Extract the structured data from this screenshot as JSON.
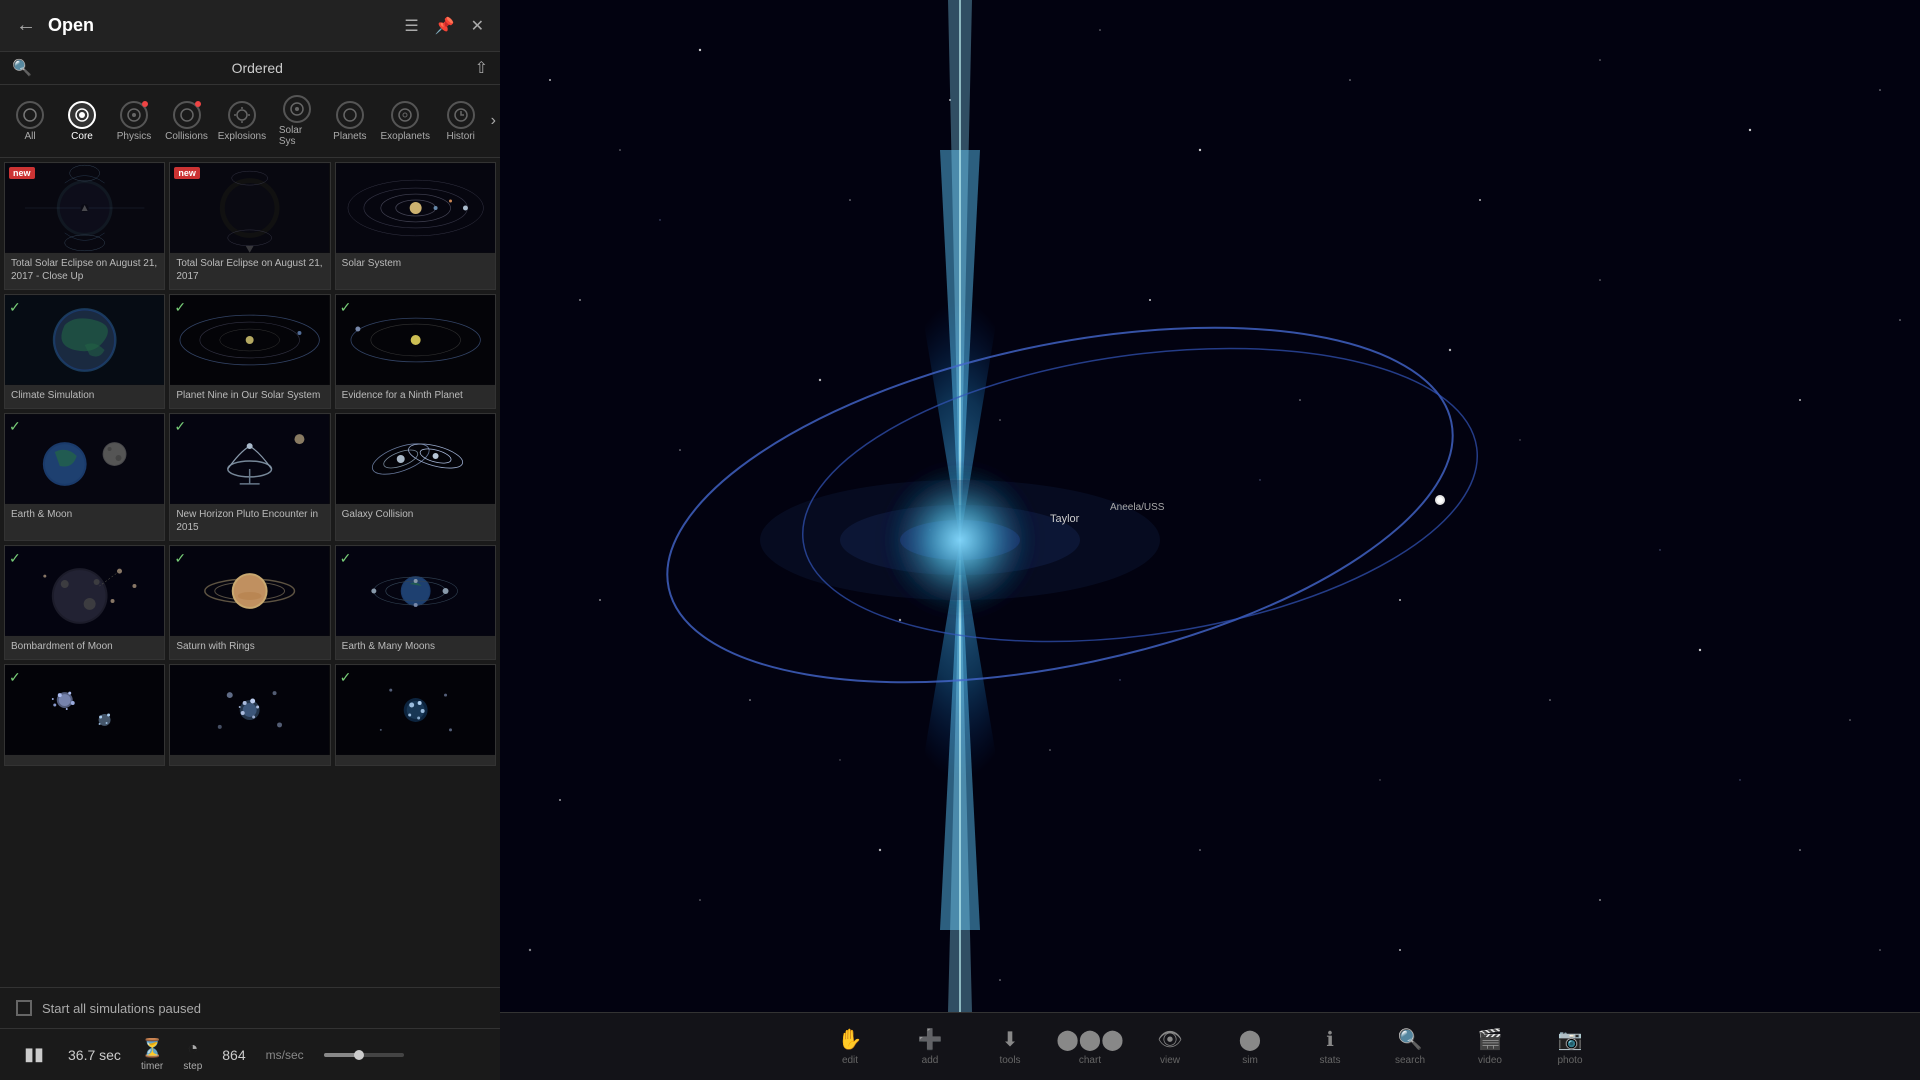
{
  "panel": {
    "title": "Open",
    "ordered_label": "Ordered",
    "categories": [
      {
        "id": "all",
        "label": "All",
        "active": false,
        "dot": false
      },
      {
        "id": "core",
        "label": "Core",
        "active": true,
        "dot": false
      },
      {
        "id": "physics",
        "label": "Physics",
        "active": false,
        "dot": true
      },
      {
        "id": "collisions",
        "label": "Collisions",
        "active": false,
        "dot": true
      },
      {
        "id": "explosions",
        "label": "Explosions",
        "active": false,
        "dot": false
      },
      {
        "id": "solarsys",
        "label": "Solar Sys",
        "active": false,
        "dot": false
      },
      {
        "id": "planets",
        "label": "Planets",
        "active": false,
        "dot": false
      },
      {
        "id": "exoplanets",
        "label": "Exoplanets",
        "active": false,
        "dot": false
      },
      {
        "id": "histori",
        "label": "Histori",
        "active": false,
        "dot": false
      }
    ],
    "simulations": [
      {
        "row": 0,
        "items": [
          {
            "id": "eclipse-closeup",
            "title": "Total Solar Eclipse on August 21, 2017 - Close Up",
            "new": true,
            "checked": false,
            "thumb": "eclipse"
          },
          {
            "id": "eclipse-2017",
            "title": "Total Solar Eclipse on August 21, 2017",
            "new": true,
            "checked": false,
            "thumb": "eclipse2"
          },
          {
            "id": "solar-system",
            "title": "Solar System",
            "new": false,
            "checked": true,
            "thumb": "solar"
          }
        ]
      },
      {
        "row": 1,
        "items": [
          {
            "id": "climate",
            "title": "Climate Simulation",
            "new": false,
            "checked": true,
            "thumb": "climate"
          },
          {
            "id": "planet9",
            "title": "Planet Nine in Our Solar System",
            "new": false,
            "checked": true,
            "thumb": "planet9"
          },
          {
            "id": "ninth-planet",
            "title": "Evidence for a Ninth Planet",
            "new": false,
            "checked": true,
            "thumb": "ninth"
          }
        ]
      },
      {
        "row": 2,
        "items": [
          {
            "id": "earth-moon",
            "title": "Earth & Moon",
            "new": false,
            "checked": true,
            "thumb": "moon"
          },
          {
            "id": "pluto",
            "title": "New Horizon Pluto Encounter in 2015",
            "new": false,
            "checked": true,
            "thumb": "pluto"
          },
          {
            "id": "galaxy-collision",
            "title": "Galaxy Collision",
            "new": false,
            "checked": false,
            "thumb": "galaxy"
          }
        ]
      },
      {
        "row": 3,
        "items": [
          {
            "id": "bombard-moon",
            "title": "Bombardment of Moon",
            "new": false,
            "checked": true,
            "thumb": "bombard"
          },
          {
            "id": "saturn-rings",
            "title": "Saturn with Rings",
            "new": false,
            "checked": true,
            "thumb": "saturn"
          },
          {
            "id": "earth-manymoons",
            "title": "Earth & Many Moons",
            "new": false,
            "checked": true,
            "thumb": "manymoons"
          }
        ]
      },
      {
        "row": 4,
        "items": [
          {
            "id": "dark1",
            "title": "",
            "new": false,
            "checked": true,
            "thumb": "dark1"
          },
          {
            "id": "dark2",
            "title": "",
            "new": false,
            "checked": false,
            "thumb": "dark2"
          },
          {
            "id": "dark3",
            "title": "",
            "new": false,
            "checked": true,
            "thumb": "dark3"
          }
        ]
      }
    ],
    "start_paused_label": "Start all simulations paused"
  },
  "statusbar": {
    "time": "36.7 sec",
    "speed": "864",
    "speed_unit": "ms/sec",
    "timer_label": "timer",
    "step_label": "step"
  },
  "toolbar": {
    "items": [
      {
        "id": "edit",
        "label": "edit",
        "icon": "✋"
      },
      {
        "id": "add",
        "label": "add",
        "icon": "➕"
      },
      {
        "id": "tools",
        "label": "tools",
        "icon": "⬇"
      },
      {
        "id": "chart",
        "label": "chart",
        "icon": "⬤⬤⬤"
      },
      {
        "id": "view",
        "label": "view",
        "icon": "👁"
      },
      {
        "id": "sim",
        "label": "sim",
        "icon": "⬤"
      },
      {
        "id": "stats",
        "label": "stats",
        "icon": "ℹ"
      },
      {
        "id": "search",
        "label": "search",
        "icon": "🔍"
      },
      {
        "id": "video",
        "label": "video",
        "icon": "🎬"
      },
      {
        "id": "photo",
        "label": "photo",
        "icon": "📷"
      }
    ]
  },
  "space_label": "Taylor",
  "space_label2": "Aneela/USS"
}
